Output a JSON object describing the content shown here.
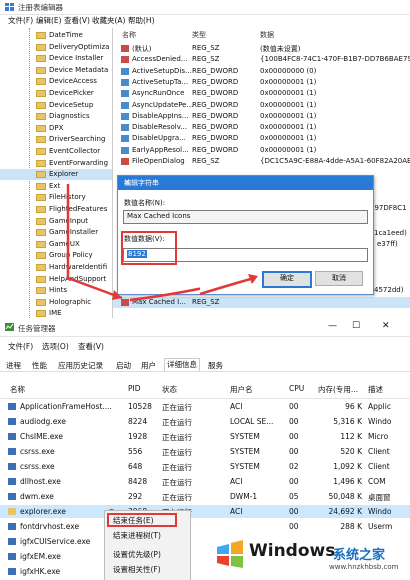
{
  "regedit": {
    "title": "注册表编辑器",
    "menu": [
      "文件(F)",
      "编辑(E)",
      "查看(V)",
      "收藏夹(A)",
      "帮助(H)"
    ],
    "tree": [
      "DateTime",
      "DeliveryOptimiza",
      "Device Installer",
      "Device Metadata",
      "DeviceAccess",
      "DevicePicker",
      "DeviceSetup",
      "Diagnostics",
      "DPX",
      "DriverSearching",
      "EventCollector",
      "EventForwarding",
      "Explorer",
      "Ext",
      "FileHistory",
      "FlightedFeatures",
      "GameInput",
      "GameInstaller",
      "GameUX",
      "Group Policy",
      "HardwareIdentifi",
      "HelpAndSupport",
      "Hints",
      "Holographic",
      "IME"
    ],
    "selected_tree": "Explorer",
    "columns": {
      "name": "名称",
      "type": "类型",
      "data": "数据"
    },
    "values": [
      {
        "name": "(默认)",
        "type": "REG_SZ",
        "data": "(数值未设置)"
      },
      {
        "name": "AccessDenied...",
        "type": "REG_SZ",
        "data": "{100B4FC8-74C1-470F-B1B7-DD7B6BAE79B"
      },
      {
        "name": "ActiveSetupDis...",
        "type": "REG_DWORD",
        "data": "0x00000000 (0)"
      },
      {
        "name": "ActiveSetupTa...",
        "type": "REG_DWORD",
        "data": "0x00000001 (1)"
      },
      {
        "name": "AsyncRunOnce",
        "type": "REG_DWORD",
        "data": "0x00000001 (1)"
      },
      {
        "name": "AsyncUpdatePe...",
        "type": "REG_DWORD",
        "data": "0x00000001 (1)"
      },
      {
        "name": "DisableAppIns...",
        "type": "REG_DWORD",
        "data": "0x00000001 (1)"
      },
      {
        "name": "DisableResolv...",
        "type": "REG_DWORD",
        "data": "0x00000001 (1)"
      },
      {
        "name": "DisableUpgra...",
        "type": "REG_DWORD",
        "data": "0x00000001 (1)"
      },
      {
        "name": "EarlyAppResol...",
        "type": "REG_DWORD",
        "data": "0x00000001 (1)"
      },
      {
        "name": "FileOpenDialog",
        "type": "REG_SZ",
        "data": "{DC1C5A9C-E88A-4dde-A5A1-60F82A20AEF"
      }
    ],
    "partial_data": [
      "097DF8C1",
      "1ca1eed)",
      "e37ff)",
      "4572dd)"
    ],
    "last_row": {
      "name": "Max Cached I...",
      "type": "REG_SZ"
    },
    "dialog": {
      "title": "编辑字符串",
      "name_label": "数值名称(N):",
      "name_value": "Max Cached Icons",
      "data_label": "数值数据(V):",
      "data_value": "8192",
      "ok": "确定",
      "cancel": "取消"
    }
  },
  "taskmgr": {
    "title": "任务管理器",
    "menu": [
      "文件(F)",
      "选项(O)",
      "查看(V)"
    ],
    "tabs": [
      "进程",
      "性能",
      "应用历史记录",
      "启动",
      "用户",
      "详细信息",
      "服务"
    ],
    "active_tab": "详细信息",
    "headers": [
      "名称",
      "PID",
      "状态",
      "用户名",
      "CPU",
      "内存(专用...",
      "描述"
    ],
    "rows": [
      [
        "ApplicationFrameHost....",
        "10528",
        "正在运行",
        "ACI",
        "00",
        "96 K",
        "Applic"
      ],
      [
        "audiodg.exe",
        "8224",
        "正在运行",
        "LOCAL SE...",
        "00",
        "5,316 K",
        "Windo"
      ],
      [
        "ChsIME.exe",
        "1928",
        "正在运行",
        "SYSTEM",
        "00",
        "112 K",
        "Micro"
      ],
      [
        "csrss.exe",
        "556",
        "正在运行",
        "SYSTEM",
        "00",
        "520 K",
        "Client"
      ],
      [
        "csrss.exe",
        "648",
        "正在运行",
        "SYSTEM",
        "02",
        "1,092 K",
        "Client"
      ],
      [
        "dllhost.exe",
        "8428",
        "正在运行",
        "ACI",
        "00",
        "1,496 K",
        "COM"
      ],
      [
        "dwm.exe",
        "292",
        "正在运行",
        "DWM-1",
        "05",
        "50,048 K",
        "桌面窗"
      ],
      [
        "explorer.exe",
        "3068",
        "正在运行",
        "ACI",
        "00",
        "24,692 K",
        "Windo"
      ],
      [
        "fontdrvhost.exe",
        "",
        "",
        "",
        "00",
        "288 K",
        "Userm"
      ],
      [
        "igfxCUIService.exe",
        "",
        "",
        "",
        "",
        "",
        ""
      ],
      [
        "igfxEM.exe",
        "",
        "",
        "",
        "",
        "",
        ""
      ],
      [
        "igfxHK.exe",
        "",
        "",
        "",
        "",
        "",
        ""
      ]
    ],
    "context_menu": [
      "结束任务(E)",
      "结束进程树(T)",
      "设置优先级(P)",
      "设置相关性(F)"
    ],
    "watermark": {
      "brand": "Windows",
      "cn": "系统之家",
      "url": "www.hnzkhbsb.com"
    }
  }
}
